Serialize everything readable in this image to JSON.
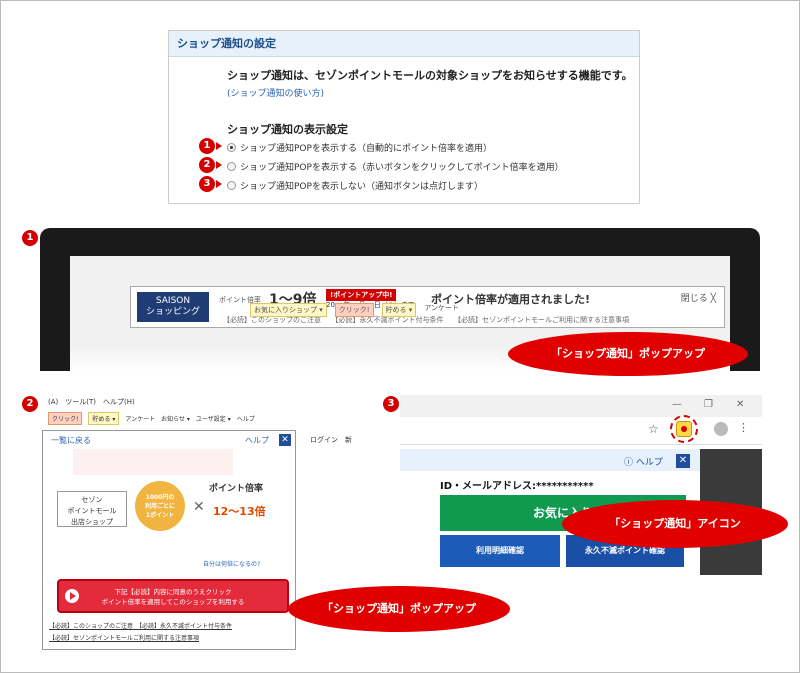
{
  "settings": {
    "header": "ショップ通知の設定",
    "description": "ショップ通知は、セゾンポイントモールの対象ショップをお知らせする機能です。",
    "howto_link": "(ショップ通知の使い方)",
    "display_title": "ショップ通知の表示設定",
    "options": [
      {
        "num": "1",
        "label": "ショップ通知POPを表示する（自動的にポイント倍率を適用）",
        "selected": true
      },
      {
        "num": "2",
        "label": "ショップ通知POPを表示する（赤いボタンをクリックしてポイント倍率を適用）",
        "selected": false
      },
      {
        "num": "3",
        "label": "ショップ通知POPを表示しない（通知ボタンは点灯します）",
        "selected": false
      }
    ]
  },
  "shot1": {
    "num": "1",
    "logo_line1": "SAISON",
    "logo_line2": "ショッピング",
    "rate_label": "ポイント倍率",
    "rate_value": "1〜9倍",
    "badge": "!ポイントアップ中!",
    "date": "20xx年xx月xx日（○）まで",
    "applied": "ポイント倍率が適用されました!",
    "close": "閉じる ╳",
    "links": "【必読】このショップのご注意　　【必読】永久不滅ポイント付与条件　　【必読】セゾンポイントモールご利用に関する注意事項",
    "tb_fav": "お気に入りショップ ▾",
    "tb_click": "クリック!",
    "tb_save": "貯める ▾",
    "tb_survey": "アンケート",
    "callout": "「ショップ通知」ポップアップ"
  },
  "shot2": {
    "num": "2",
    "menu": "(A)　ツール(T)　ヘルプ(H)",
    "tb_click": "クリック!",
    "tb_save": "貯める ▾",
    "tb_survey": "アンケート",
    "tb_notice": "お知らせ ▾",
    "tb_user": "ユーザ設定 ▾",
    "tb_help": "ヘルプ",
    "back": "一覧に戻る",
    "help": "ヘルプ",
    "close": "✕",
    "shop_l1": "セゾン",
    "shop_l2": "ポイントモール",
    "shop_l3": "出店ショップ",
    "coin_l1": "1000円の",
    "coin_l2": "利用ごとに",
    "coin_l3": "1ポイント",
    "times": "✕",
    "rate_label": "ポイント倍率",
    "rate_value": "12〜13倍",
    "what_rate": "自分は何倍になるの?",
    "button_l1": "下記【必読】内容に同意のうえクリック",
    "button_l2": "ポイント倍率を適用してこのショップを利用する",
    "note1": "【必読】このショップのご注意　【必読】永久不滅ポイント付与条件",
    "note2": "【必読】セゾンポイントモールご利用に関する注意事項",
    "login": "ログイン　新",
    "callout": "「ショップ通知」ポップアップ"
  },
  "shot3": {
    "num": "3",
    "min": "—",
    "restore": "❐",
    "close": "✕",
    "star": "☆",
    "kebab": "⋮",
    "help": "ⓘ ヘルプ",
    "x": "✕",
    "id_label": "ID・メールアドレス:***********",
    "fav": "お気に入り",
    "btn_statement": "利用明細確認",
    "btn_points": "永久不滅ポイント確認",
    "callout": "「ショップ通知」アイコン"
  },
  "colors": {
    "accent_red": "#d40000",
    "callout_red": "#e00000",
    "saison_navy": "#1f3d74",
    "green": "#0f9a50",
    "blue": "#1c5bb7"
  }
}
